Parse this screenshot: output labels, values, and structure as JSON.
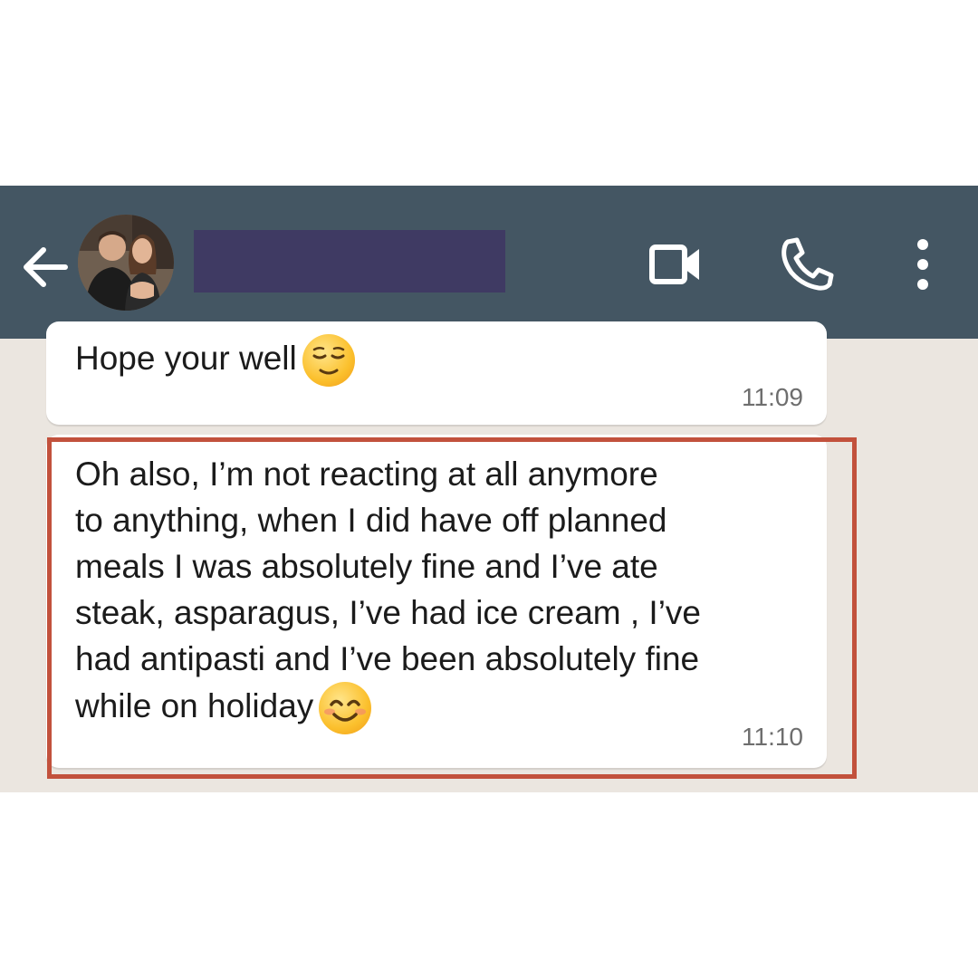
{
  "header": {
    "contact_name": "",
    "back_icon": "arrow-left-icon",
    "video_icon": "video-camera-icon",
    "call_icon": "phone-icon",
    "menu_icon": "more-vertical-icon",
    "header_color": "#445663"
  },
  "messages": [
    {
      "text": "Hope your well",
      "emoji": "relieved-face-emoji",
      "time": "11:09"
    },
    {
      "text": "Oh also, I’m not reacting at all anymore\nto anything, when I did have off planned\nmeals I was absolutely fine and I’ve ate\nsteak, asparagus, I’ve had ice cream , I’ve\nhad antipasti and I’ve been absolutely fine\nwhile on holiday",
      "emoji": "smiling-face-emoji",
      "time": "11:10",
      "highlighted": true
    }
  ],
  "colors": {
    "chat_background": "#ebe6e0",
    "highlight_border": "#c2513c",
    "name_redaction": "#3f3a63"
  }
}
